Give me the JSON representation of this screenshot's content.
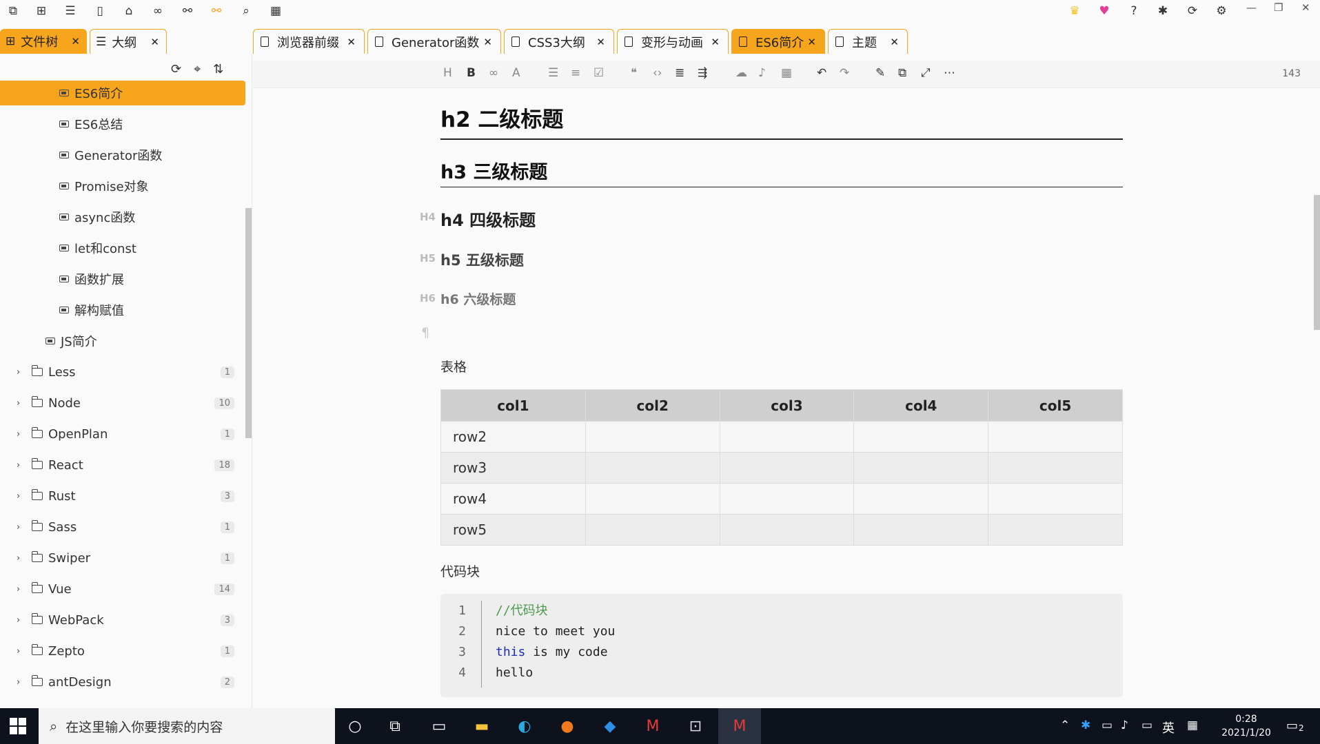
{
  "left_tabs": [
    {
      "label": "文件树",
      "active": true
    },
    {
      "label": "大纲",
      "active": false
    }
  ],
  "sidebar": {
    "items": [
      {
        "label": "ES6简介",
        "type": "doc",
        "selected": true
      },
      {
        "label": "ES6总结",
        "type": "doc"
      },
      {
        "label": "Generator函数",
        "type": "doc"
      },
      {
        "label": "Promise对象",
        "type": "doc"
      },
      {
        "label": "async函数",
        "type": "doc"
      },
      {
        "label": "let和const",
        "type": "doc"
      },
      {
        "label": "函数扩展",
        "type": "doc"
      },
      {
        "label": "解构赋值",
        "type": "doc"
      },
      {
        "label": "JS简介",
        "type": "doc"
      },
      {
        "label": "Less",
        "type": "folder",
        "count": "1"
      },
      {
        "label": "Node",
        "type": "folder",
        "count": "10"
      },
      {
        "label": "OpenPlan",
        "type": "folder",
        "count": "1"
      },
      {
        "label": "React",
        "type": "folder",
        "count": "18"
      },
      {
        "label": "Rust",
        "type": "folder",
        "count": "3"
      },
      {
        "label": "Sass",
        "type": "folder",
        "count": "1"
      },
      {
        "label": "Swiper",
        "type": "folder",
        "count": "1"
      },
      {
        "label": "Vue",
        "type": "folder",
        "count": "14"
      },
      {
        "label": "WebPack",
        "type": "folder",
        "count": "3"
      },
      {
        "label": "Zepto",
        "type": "folder",
        "count": "1"
      },
      {
        "label": "antDesign",
        "type": "folder",
        "count": "2"
      }
    ]
  },
  "tabs": [
    {
      "label": "浏览器前缀",
      "active": false
    },
    {
      "label": "Generator函数",
      "active": false
    },
    {
      "label": "CSS3大纲",
      "active": false
    },
    {
      "label": "变形与动画",
      "active": false
    },
    {
      "label": "ES6简介",
      "active": true
    },
    {
      "label": "主题",
      "active": false
    }
  ],
  "toolbar": {
    "word_count": "143"
  },
  "document": {
    "h2": "h2 二级标题",
    "h3": "h3 三级标题",
    "h4": "h4 四级标题",
    "h5": "h5 五级标题",
    "h6": "h6 六级标题",
    "h4_marker": "H4",
    "h5_marker": "H5",
    "h6_marker": "H6",
    "pilcrow": "¶",
    "table_label": "表格",
    "table": {
      "headers": [
        "col1",
        "col2",
        "col3",
        "col4",
        "col5"
      ],
      "rows": [
        [
          "row2",
          "",
          "",
          "",
          ""
        ],
        [
          "row3",
          "",
          "",
          "",
          ""
        ],
        [
          "row4",
          "",
          "",
          "",
          ""
        ],
        [
          "row5",
          "",
          "",
          "",
          ""
        ]
      ]
    },
    "code_label": "代码块",
    "code": {
      "line_numbers": [
        "1",
        "2",
        "3",
        "4"
      ],
      "lines": [
        "//代码块",
        "nice to meet you",
        "this",
        " is my code",
        "hello"
      ]
    }
  },
  "taskbar": {
    "search_placeholder": "在这里输入你要搜索的内容",
    "ime": "英",
    "time": "0:28",
    "date": "2021/1/20",
    "notifications": "2"
  }
}
